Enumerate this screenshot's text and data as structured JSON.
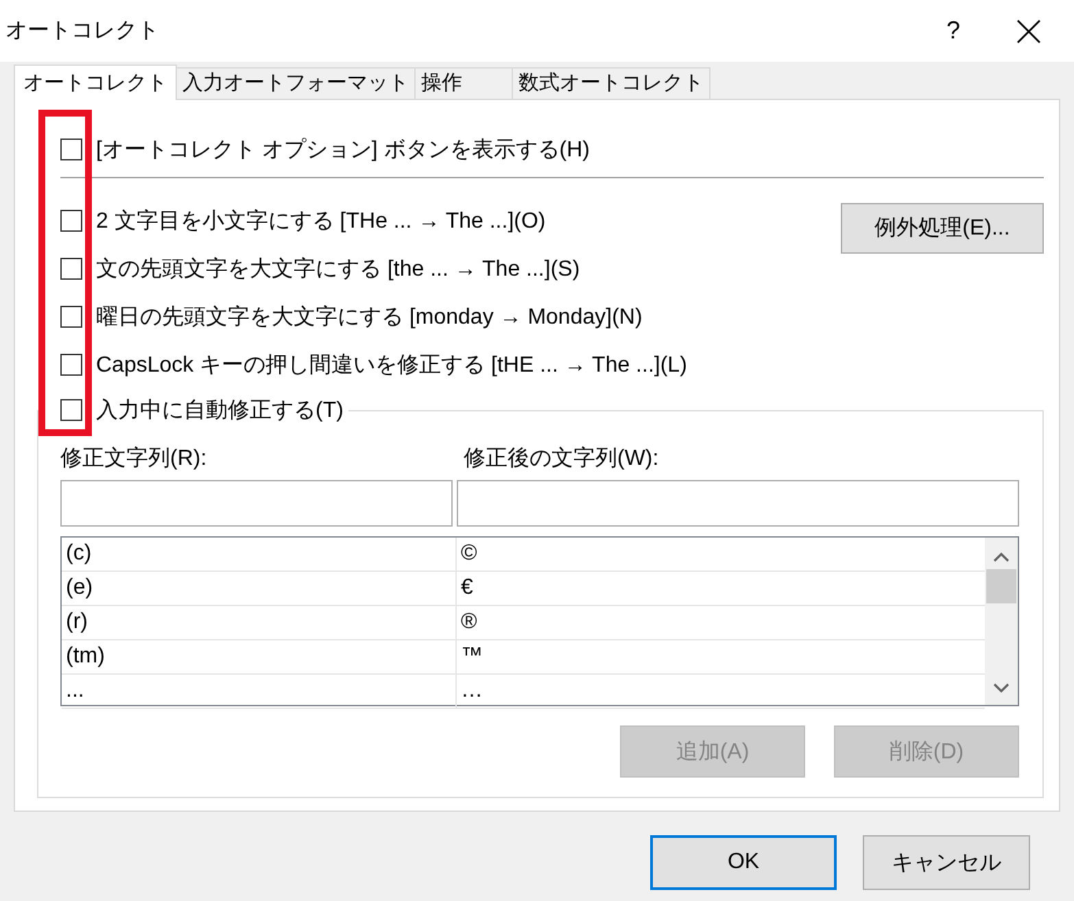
{
  "window": {
    "title": "オートコレクト",
    "help": "?"
  },
  "tabs": [
    {
      "label": "オートコレクト",
      "selected": true
    },
    {
      "label": "入力オートフォーマット",
      "selected": false
    },
    {
      "label": "操作",
      "selected": false
    },
    {
      "label": "数式オートコレクト",
      "selected": false
    }
  ],
  "show_button_option": {
    "label": "[オートコレクト オプション] ボタンを表示する(H)",
    "checked": false
  },
  "options": [
    {
      "label": "2 文字目を小文字にする [THe ... → The ...](O)",
      "checked": false
    },
    {
      "label": "文の先頭文字を大文字にする [the ... → The ...](S)",
      "checked": false
    },
    {
      "label": "曜日の先頭文字を大文字にする [monday → Monday](N)",
      "checked": false
    },
    {
      "label": "CapsLock キーの押し間違いを修正する [tHE ... → The ...](L)",
      "checked": false
    }
  ],
  "exceptions_button": "例外処理(E)...",
  "replace_group": {
    "checkbox": {
      "label": "入力中に自動修正する(T)",
      "checked": false
    },
    "replace_label": "修正文字列(R):",
    "with_label": "修正後の文字列(W):",
    "rows": [
      {
        "replace": "(c)",
        "with": "©"
      },
      {
        "replace": "(e)",
        "with": "€"
      },
      {
        "replace": "(r)",
        "with": "®"
      },
      {
        "replace": "(tm)",
        "with": "™"
      },
      {
        "replace": "...",
        "with": "…"
      }
    ],
    "buttons": [
      {
        "label": "追加(A)",
        "disabled": true
      },
      {
        "label": "削除(D)",
        "disabled": true
      }
    ]
  },
  "buttons": [
    {
      "label": "OK",
      "default": true
    },
    {
      "label": "キャンセル",
      "default": false
    }
  ]
}
